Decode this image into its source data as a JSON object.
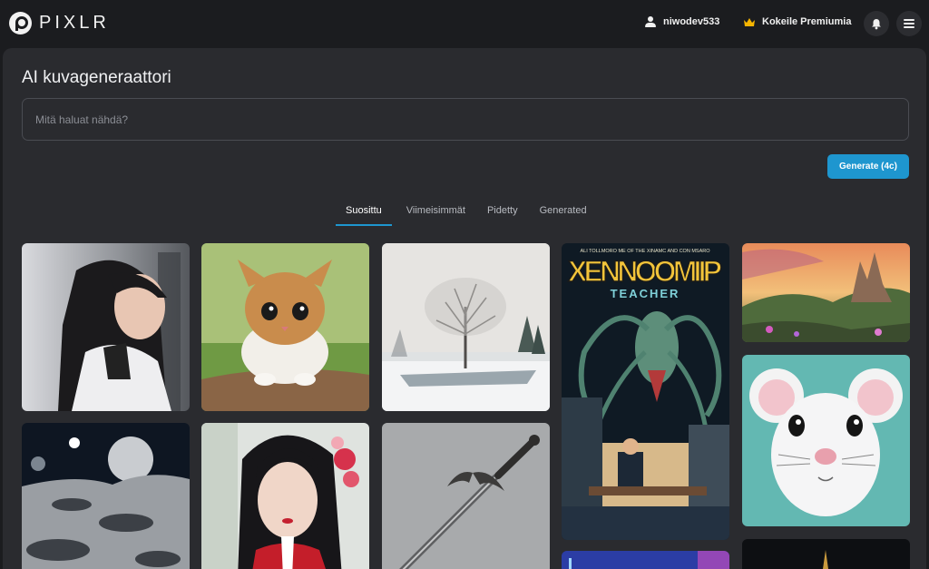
{
  "topbar": {
    "logo_text": "PIXLR",
    "username": "niwodev533",
    "premium_label": "Kokeile Premiumia"
  },
  "main": {
    "title": "AI kuvageneraattori",
    "prompt_placeholder": "Mitä haluat nähdä?",
    "prompt_value": "",
    "generate_label": "Generate (4c)",
    "tabs": [
      {
        "label": "Suosittu",
        "active": true
      },
      {
        "label": "Viimeisimmät",
        "active": false
      },
      {
        "label": "Pidetty",
        "active": false
      },
      {
        "label": "Generated",
        "active": false
      }
    ]
  },
  "gallery": {
    "items": [
      {
        "subject": "portrait-woman-ponytail"
      },
      {
        "subject": "kitten-on-rock"
      },
      {
        "subject": "winter-tree-lake"
      },
      {
        "subject": "alien-poster",
        "poster_title": "XENNOOMIIP",
        "poster_subtitle": "TEACHER",
        "poster_top": "ALI TOLLMORO ME OF THE XINAMC AND CON MSARO"
      },
      {
        "subject": "fantasy-castle-landscape"
      },
      {
        "subject": "white-mouse-cartoon"
      },
      {
        "subject": "moon-surface"
      },
      {
        "subject": "asian-woman-flowers"
      },
      {
        "subject": "sword"
      },
      {
        "subject": "city-night-partial"
      },
      {
        "subject": "dark-partial"
      }
    ]
  },
  "colors": {
    "accent": "#1e96cf",
    "background": "#1b1c1f",
    "panel": "#2a2b2f"
  }
}
